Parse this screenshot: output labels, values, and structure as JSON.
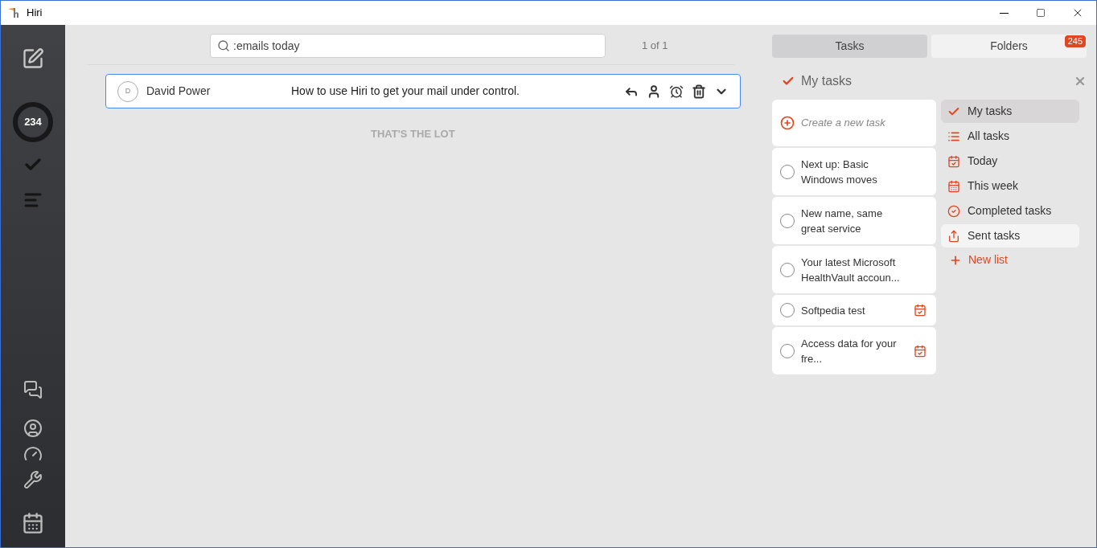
{
  "window": {
    "title": "Hiri"
  },
  "sidebar": {
    "unread_count": "234"
  },
  "search": {
    "value": ":emails today",
    "result_count": "1 of 1"
  },
  "emails": [
    {
      "avatar": "D",
      "sender": "David Power",
      "subject": "How to use Hiri to get your mail under control.",
      "selected": true
    }
  ],
  "end_message": "THAT'S THE LOT",
  "tabs": [
    {
      "label": "Tasks",
      "selected": true
    },
    {
      "label": "Folders",
      "selected": false,
      "badge": "245"
    }
  ],
  "tasks_header": "My tasks",
  "new_task": {
    "placeholder": "Create a new task"
  },
  "tasks": [
    {
      "title": "Next up: Basic Windows moves",
      "checked": false,
      "due": false
    },
    {
      "title": "New name, same great service",
      "checked": false,
      "due": false
    },
    {
      "title": "Your latest Microsoft HealthVault accoun...",
      "checked": false,
      "due": false
    },
    {
      "title": "Softpedia test",
      "checked": false,
      "due": true
    },
    {
      "title": "Access data for your fre...",
      "checked": false,
      "due": true
    }
  ],
  "lists": [
    {
      "label": "My tasks",
      "kind": "check",
      "selected": true,
      "hovered": false
    },
    {
      "label": "All tasks",
      "kind": "all",
      "selected": false,
      "hovered": false
    },
    {
      "label": "Today",
      "kind": "today",
      "selected": false,
      "hovered": false
    },
    {
      "label": "This week",
      "kind": "week",
      "selected": false,
      "hovered": false
    },
    {
      "label": "Completed tasks",
      "kind": "completed",
      "selected": false,
      "hovered": false
    },
    {
      "label": "Sent tasks",
      "kind": "sent",
      "selected": false,
      "hovered": true
    }
  ],
  "new_list": "New list"
}
